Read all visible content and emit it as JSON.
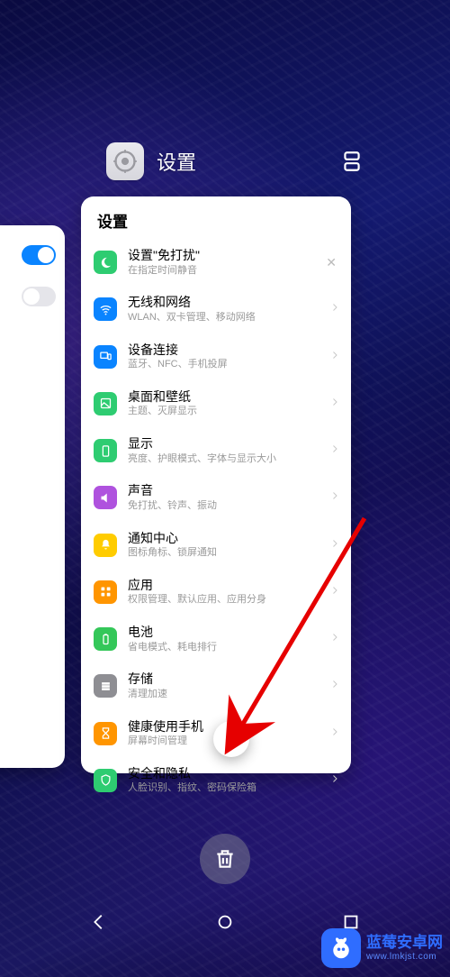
{
  "header": {
    "app_title": "设置"
  },
  "settings_card": {
    "title": "设置",
    "items": [
      {
        "title": "设置\"免打扰\"",
        "sub": "在指定时间静音"
      },
      {
        "title": "无线和网络",
        "sub": "WLAN、双卡管理、移动网络"
      },
      {
        "title": "设备连接",
        "sub": "蓝牙、NFC、手机投屏"
      },
      {
        "title": "桌面和壁纸",
        "sub": "主题、灭屏显示"
      },
      {
        "title": "显示",
        "sub": "亮度、护眼模式、字体与显示大小"
      },
      {
        "title": "声音",
        "sub": "免打扰、铃声、振动"
      },
      {
        "title": "通知中心",
        "sub": "图标角标、锁屏通知"
      },
      {
        "title": "应用",
        "sub": "权限管理、默认应用、应用分身"
      },
      {
        "title": "电池",
        "sub": "省电模式、耗电排行"
      },
      {
        "title": "存储",
        "sub": "清理加速"
      },
      {
        "title": "健康使用手机",
        "sub": "屏幕时间管理"
      },
      {
        "title": "安全和隐私",
        "sub": "人脸识别、指纹、密码保险箱"
      }
    ]
  },
  "watermark": {
    "title": "蓝莓安卓网",
    "url": "www.lmkjst.com"
  }
}
